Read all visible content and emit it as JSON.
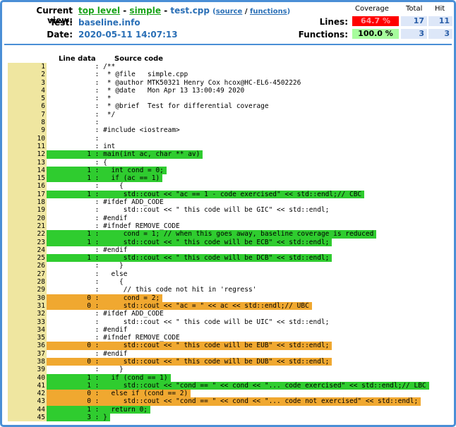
{
  "header": {
    "current_view_label": "Current view:",
    "crumb_top": "top level",
    "crumb_sep1": " - ",
    "crumb_dir": "simple",
    "crumb_sep2": " - ",
    "crumb_file": "test.cpp",
    "crumb_links_open": "(",
    "source_link": "source",
    "links_sep": " / ",
    "functions_link": "functions",
    "crumb_links_close": ")",
    "test_label": "Test:",
    "test_value": "baseline.info",
    "date_label": "Date:",
    "date_value": "2020-05-11 14:07:13"
  },
  "stats": {
    "col_coverage": "Coverage",
    "col_total": "Total",
    "col_hit": "Hit",
    "lines_label": "Lines:",
    "lines_coverage": "64.7 %",
    "lines_total": "17",
    "lines_hit": "11",
    "functions_label": "Functions:",
    "functions_coverage": "100.0 %",
    "functions_total": "3",
    "functions_hit": "3"
  },
  "colors": {
    "low_coverage": "#ff0000",
    "high_coverage": "#a7fc9d",
    "hit_line": "#2fcc2f",
    "missed_line": "#f0a830",
    "line_number_bg": "#efe6a0",
    "accent": "#4a8fd6"
  },
  "table": {
    "line_data_header": "Line data",
    "source_header": "Source code"
  },
  "lines": [
    {
      "n": "1",
      "count": "",
      "status": "",
      "text": "/**"
    },
    {
      "n": "2",
      "count": "",
      "status": "",
      "text": " * @file   simple.cpp"
    },
    {
      "n": "3",
      "count": "",
      "status": "",
      "text": " * @author MTK50321 Henry Cox hcox@HC-EL6-4502226"
    },
    {
      "n": "4",
      "count": "",
      "status": "",
      "text": " * @date   Mon Apr 13 13:00:49 2020"
    },
    {
      "n": "5",
      "count": "",
      "status": "",
      "text": " *"
    },
    {
      "n": "6",
      "count": "",
      "status": "",
      "text": " * @brief  Test for differential coverage"
    },
    {
      "n": "7",
      "count": "",
      "status": "",
      "text": " */"
    },
    {
      "n": "8",
      "count": "",
      "status": "",
      "text": ""
    },
    {
      "n": "9",
      "count": "",
      "status": "",
      "text": "#include <iostream>"
    },
    {
      "n": "10",
      "count": "",
      "status": "",
      "text": ""
    },
    {
      "n": "11",
      "count": "",
      "status": "",
      "text": "int"
    },
    {
      "n": "12",
      "count": "1",
      "status": "hit",
      "text": "main(int ac, char ** av)"
    },
    {
      "n": "13",
      "count": "",
      "status": "",
      "text": "{"
    },
    {
      "n": "14",
      "count": "1",
      "status": "hit",
      "text": "  int cond = 0;"
    },
    {
      "n": "15",
      "count": "1",
      "status": "hit",
      "text": "  if (ac == 1)"
    },
    {
      "n": "16",
      "count": "",
      "status": "",
      "text": "    {"
    },
    {
      "n": "17",
      "count": "1",
      "status": "hit",
      "text": "     std::cout << \"ac == 1 - code exercised\" << std::endl;// CBC"
    },
    {
      "n": "18",
      "count": "",
      "status": "",
      "text": "#ifdef ADD_CODE"
    },
    {
      "n": "19",
      "count": "",
      "status": "",
      "text": "     std::cout << \" this code will be GIC\" << std::endl;"
    },
    {
      "n": "20",
      "count": "",
      "status": "",
      "text": "#endif"
    },
    {
      "n": "21",
      "count": "",
      "status": "",
      "text": "#ifndef REMOVE_CODE"
    },
    {
      "n": "22",
      "count": "1",
      "status": "hit",
      "text": "     cond = 1; // when this goes away, baseline coverage is reduced"
    },
    {
      "n": "23",
      "count": "1",
      "status": "hit",
      "text": "     std::cout << \" this code will be ECB\" << std::endl;"
    },
    {
      "n": "24",
      "count": "",
      "status": "",
      "text": "#endif"
    },
    {
      "n": "25",
      "count": "1",
      "status": "hit",
      "text": "     std::cout << \" this code will be DCB\" << std::endl;"
    },
    {
      "n": "26",
      "count": "",
      "status": "",
      "text": "    }"
    },
    {
      "n": "27",
      "count": "",
      "status": "",
      "text": "  else"
    },
    {
      "n": "28",
      "count": "",
      "status": "",
      "text": "    {"
    },
    {
      "n": "29",
      "count": "",
      "status": "",
      "text": "     // this code not hit in 'regress'"
    },
    {
      "n": "30",
      "count": "0",
      "status": "miss",
      "text": "     cond = 2;"
    },
    {
      "n": "31",
      "count": "0",
      "status": "miss",
      "text": "     std::cout << \"ac = \" << ac << std::endl;// UBC"
    },
    {
      "n": "32",
      "count": "",
      "status": "",
      "text": "#ifdef ADD_CODE"
    },
    {
      "n": "33",
      "count": "",
      "status": "",
      "text": "     std::cout << \" this code will be UIC\" << std::endl;"
    },
    {
      "n": "34",
      "count": "",
      "status": "",
      "text": "#endif"
    },
    {
      "n": "35",
      "count": "",
      "status": "",
      "text": "#ifndef REMOVE_CODE"
    },
    {
      "n": "36",
      "count": "0",
      "status": "miss",
      "text": "     std::cout << \" this code will be EUB\" << std::endl;"
    },
    {
      "n": "37",
      "count": "",
      "status": "",
      "text": "#endif"
    },
    {
      "n": "38",
      "count": "0",
      "status": "miss",
      "text": "     std::cout << \" this code will be DUB\" << std::endl;"
    },
    {
      "n": "39",
      "count": "",
      "status": "",
      "text": "    }"
    },
    {
      "n": "40",
      "count": "1",
      "status": "hit",
      "text": "  if (cond == 1)"
    },
    {
      "n": "41",
      "count": "1",
      "status": "hit",
      "text": "     std::cout << \"cond == \" << cond << \"... code exercised\" << std::endl;// LBC"
    },
    {
      "n": "42",
      "count": "0",
      "status": "miss",
      "text": "  else if (cond == 2)"
    },
    {
      "n": "43",
      "count": "0",
      "status": "miss",
      "text": "     std::cout << \"cond == \" << cond << \"... code not exercised\" << std::endl;"
    },
    {
      "n": "44",
      "count": "1",
      "status": "hit",
      "text": "  return 0;"
    },
    {
      "n": "45",
      "count": "3",
      "status": "hit",
      "text": "}"
    }
  ]
}
